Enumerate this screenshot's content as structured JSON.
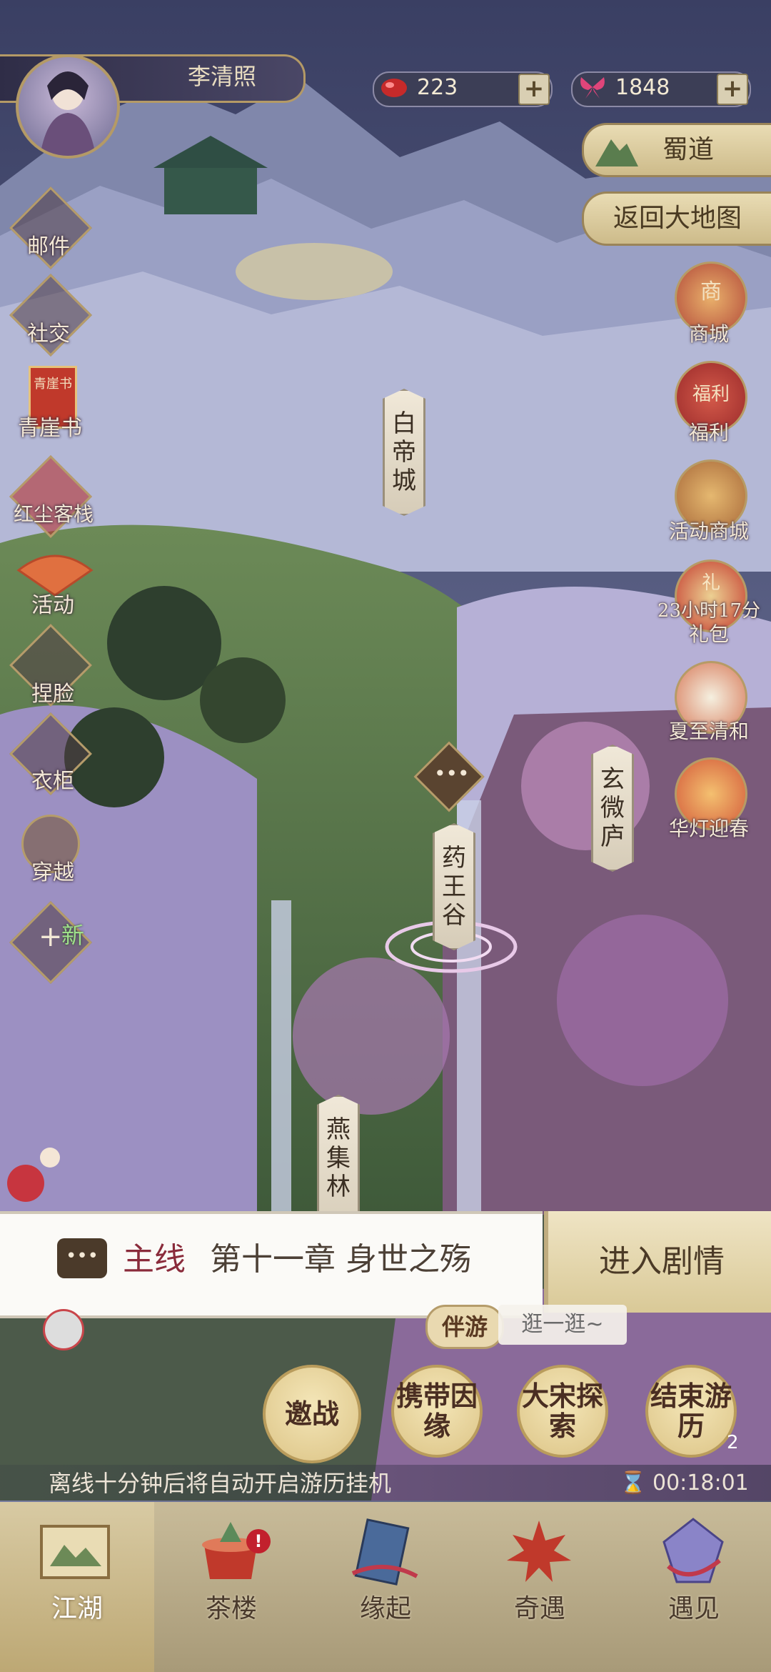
{
  "player": {
    "name": "李清照"
  },
  "resources": {
    "jade": {
      "value": "223"
    },
    "butterfly": {
      "value": "1848"
    },
    "plus": "+"
  },
  "region": {
    "name": "蜀道",
    "return_label": "返回大地图"
  },
  "left_menu": [
    {
      "key": "mail",
      "label": "邮件"
    },
    {
      "key": "social",
      "label": "社交"
    },
    {
      "key": "qingyashu",
      "label": "青崖书",
      "icon_text": "青崖书"
    },
    {
      "key": "inn",
      "label": "红尘客栈"
    },
    {
      "key": "events",
      "label": "活动"
    },
    {
      "key": "face",
      "label": "捏脸"
    },
    {
      "key": "wardrobe",
      "label": "衣柜"
    },
    {
      "key": "travel",
      "label": "穿越"
    },
    {
      "key": "new",
      "label": "新"
    }
  ],
  "right_menu": [
    {
      "key": "shop",
      "label": "商城",
      "icon_text": "商"
    },
    {
      "key": "welfare",
      "label": "福利",
      "icon_text": "福利"
    },
    {
      "key": "event_shop",
      "label": "活动商城"
    },
    {
      "key": "gift",
      "label": "礼包",
      "timer": "23小时17分",
      "icon_text": "礼"
    },
    {
      "key": "summer",
      "label": "夏至清和"
    },
    {
      "key": "lantern",
      "label": "华灯迎春"
    }
  ],
  "locations": [
    {
      "key": "baidi",
      "name": [
        "白",
        "帝",
        "城"
      ]
    },
    {
      "key": "xuanwei",
      "name": [
        "玄",
        "微",
        "庐"
      ]
    },
    {
      "key": "yaowang",
      "name": [
        "药",
        "王",
        "谷"
      ]
    },
    {
      "key": "yanji",
      "name": [
        "燕",
        "集",
        "林"
      ]
    }
  ],
  "quest": {
    "tag": "主线",
    "title": "第十一章 身世之殇",
    "enter_label": "进入剧情"
  },
  "companion": {
    "badge": "伴游",
    "text": "逛一逛~"
  },
  "actions": [
    {
      "key": "challenge",
      "label": "邀战"
    },
    {
      "key": "carry",
      "label": "携带因缘"
    },
    {
      "key": "explore",
      "label": "大宋探索"
    },
    {
      "key": "end",
      "label": "结束游历",
      "count": "2"
    }
  ],
  "idle": {
    "text": "离线十分钟后将自动开启游历挂机",
    "timer": "00:18:01"
  },
  "nav": [
    {
      "key": "jianghu",
      "label": "江湖",
      "active": true
    },
    {
      "key": "chalou",
      "label": "茶楼",
      "alert": "!"
    },
    {
      "key": "yuanqi",
      "label": "缘起"
    },
    {
      "key": "qiyu",
      "label": "奇遇"
    },
    {
      "key": "yujian",
      "label": "遇见"
    }
  ],
  "colors": {
    "sky": "#3d4466",
    "mountain": "#6f7498",
    "green_hill": "#5b7a4a",
    "purple_valley": "#8a7fb6",
    "gold_trim": "#b49a66",
    "quest_red": "#8a2b3b"
  }
}
